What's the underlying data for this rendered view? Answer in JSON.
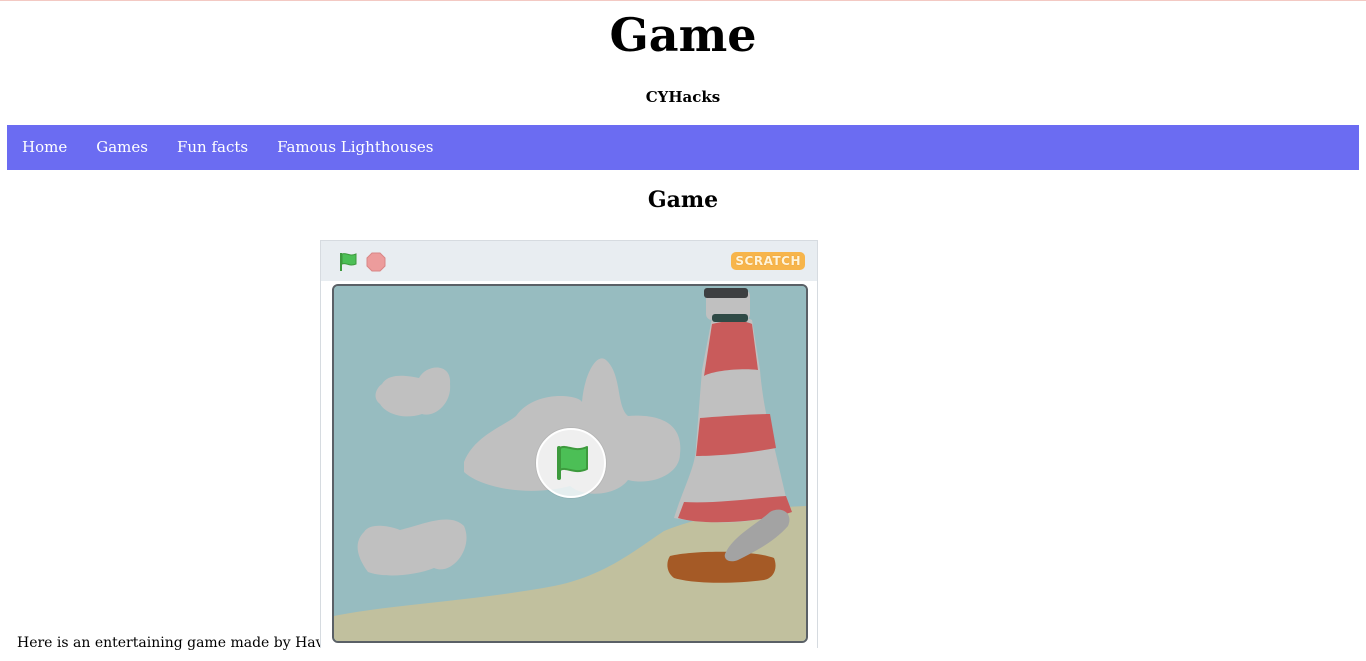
{
  "header": {
    "title": "Game",
    "subtitle": "CYHacks"
  },
  "nav": {
    "items": [
      {
        "label": "Home"
      },
      {
        "label": "Games"
      },
      {
        "label": "Fun facts"
      },
      {
        "label": "Famous Lighthouses"
      }
    ],
    "background_color": "#6b6cf2"
  },
  "main": {
    "heading": "Game",
    "intro": "Here is an entertaining game made by Havah:"
  },
  "scratch_player": {
    "logo_text": "SCRATCH",
    "toolbar_icons": [
      "green-flag-icon",
      "stop-icon"
    ],
    "overlay_icon": "green-flag-icon",
    "stage_colors": {
      "sky": "#97bcc0",
      "sand": "#c1c09e",
      "clouds": "#c0c0c0",
      "stripe_red": "#c95b5b",
      "base": "#a55a26"
    }
  }
}
